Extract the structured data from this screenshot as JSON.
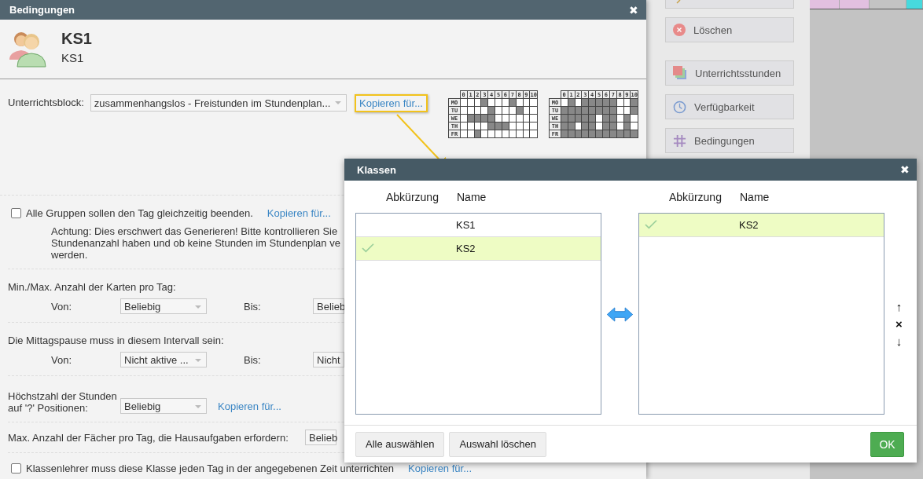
{
  "main_dialog": {
    "title": "Bedingungen",
    "close": "✖",
    "class_code": "KS1",
    "class_name": "KS1"
  },
  "block": {
    "label": "Unterrichtsblock:",
    "value": "zusammenhangslos - Freistunden im Stundenplan...",
    "link": "Kopieren für...",
    "highlighted": true
  },
  "grids": [
    {
      "columns": [
        "0",
        "1",
        "2",
        "3",
        "4",
        "5",
        "6",
        "7",
        "8",
        "9",
        "10"
      ],
      "days": [
        "MO",
        "TU",
        "WE",
        "TH",
        "FR"
      ],
      "cells": [
        [
          false,
          false,
          false,
          true,
          false,
          false,
          false,
          true,
          false,
          false,
          false
        ],
        [
          false,
          false,
          false,
          false,
          true,
          false,
          false,
          false,
          true,
          false,
          false
        ],
        [
          false,
          true,
          true,
          true,
          true,
          false,
          false,
          false,
          false,
          false,
          false
        ],
        [
          false,
          false,
          false,
          false,
          true,
          true,
          true,
          false,
          false,
          false,
          false
        ],
        [
          false,
          false,
          true,
          false,
          false,
          false,
          false,
          false,
          false,
          false,
          false
        ]
      ]
    },
    {
      "columns": [
        "0",
        "1",
        "2",
        "3",
        "4",
        "5",
        "6",
        "7",
        "8",
        "9",
        "10"
      ],
      "days": [
        "MO",
        "TU",
        "WE",
        "TH",
        "FR"
      ],
      "cells": [
        [
          false,
          true,
          false,
          true,
          true,
          true,
          true,
          true,
          false,
          false,
          true
        ],
        [
          true,
          true,
          true,
          true,
          true,
          true,
          true,
          true,
          false,
          false,
          true
        ],
        [
          true,
          true,
          true,
          true,
          true,
          false,
          true,
          true,
          false,
          true,
          false
        ],
        [
          true,
          true,
          false,
          true,
          true,
          false,
          true,
          true,
          false,
          true,
          false
        ],
        [
          true,
          true,
          true,
          true,
          true,
          true,
          true,
          true,
          true,
          true,
          true
        ]
      ]
    }
  ],
  "sections": [
    {
      "kind": "checkbox",
      "label": "Alle Gruppen sollen den Tag gleichzeitig beenden.",
      "checked": false,
      "link": "Kopieren für...",
      "note": [
        "Achtung: Dies erschwert das Generieren! Bitte kontrollieren Sie",
        "Stundenanzahl haben und ob keine Stunden im Stundenplan ve",
        "werden."
      ]
    },
    {
      "kind": "range",
      "title": "Min./Max. Anzahl der Karten pro Tag:",
      "from_label": "Von:",
      "from_value": "Beliebig",
      "to_label": "Bis:",
      "to_value": "Belieb"
    },
    {
      "kind": "range",
      "title": "Die Mittagspause muss in diesem Intervall sein:",
      "from_label": "Von:",
      "from_value": "Nicht aktive ...",
      "to_label": "Bis:",
      "to_value": "Nicht"
    },
    {
      "kind": "single",
      "label": [
        "Höchstzahl der Stunden",
        "auf '?' Positionen:"
      ],
      "value": "Beliebig",
      "link": "Kopieren für..."
    },
    {
      "kind": "inline",
      "label": "Max. Anzahl der Fächer pro Tag, die  Hausaufgaben erfordern:",
      "value": "Belieb"
    },
    {
      "kind": "checkbox",
      "label": "Klassenlehrer muss diese Klasse jeden Tag in der angegebenen Zeit unterrichten",
      "checked": false,
      "link": "Kopieren für..."
    }
  ],
  "side_buttons": [
    {
      "kind": "delete",
      "label": "Löschen"
    },
    {
      "kind": "lessons",
      "label": "Unterrichtsstunden"
    },
    {
      "kind": "availability",
      "label": "Verfügbarkeit"
    },
    {
      "kind": "constraints",
      "label": "Bedingungen"
    }
  ],
  "classes_dialog": {
    "title": "Klassen",
    "close": "✖",
    "left_list": {
      "columns": [
        "Abkürzung",
        "Name"
      ],
      "rows": [
        {
          "name": "KS1",
          "selected": false
        },
        {
          "name": "KS2",
          "selected": true
        }
      ]
    },
    "right_list": {
      "columns": [
        "Abkürzung",
        "Name"
      ],
      "rows": [
        {
          "name": "KS2",
          "selected": true
        }
      ]
    },
    "move_controls": [
      "↑",
      "×",
      "↓"
    ],
    "buttons": [
      "Alle auswählen",
      "Auswahl löschen"
    ],
    "ok": "OK"
  }
}
